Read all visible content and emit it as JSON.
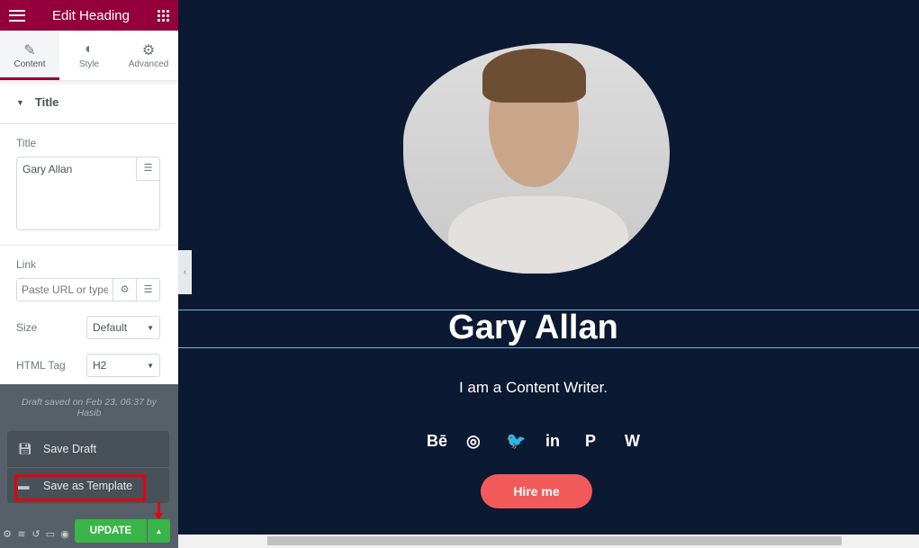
{
  "panel": {
    "title": "Edit Heading",
    "tabs": [
      {
        "label": "Content",
        "icon": "pencil-icon"
      },
      {
        "label": "Style",
        "icon": "contrast-icon"
      },
      {
        "label": "Advanced",
        "icon": "gear-icon"
      }
    ],
    "section": "Title",
    "title_label": "Title",
    "title_value": "Gary Allan",
    "link_label": "Link",
    "link_placeholder": "Paste URL or type",
    "size_label": "Size",
    "size_value": "Default",
    "tag_label": "HTML Tag",
    "tag_value": "H2"
  },
  "footer": {
    "draft_status": "Draft saved on Feb 23, 06:37 by Hasib",
    "menu": [
      "Save Draft",
      "Save as Template"
    ],
    "update": "UPDATE"
  },
  "canvas": {
    "name": "Gary Allan",
    "subtitle": "I am a Content Writer.",
    "social": [
      "Bē",
      "◎",
      "🐦",
      "in",
      "P",
      "W"
    ],
    "button": "Hire me",
    "colors": {
      "background": "#0c1932",
      "button": "#f25a5a",
      "accent": "#93003c"
    }
  }
}
